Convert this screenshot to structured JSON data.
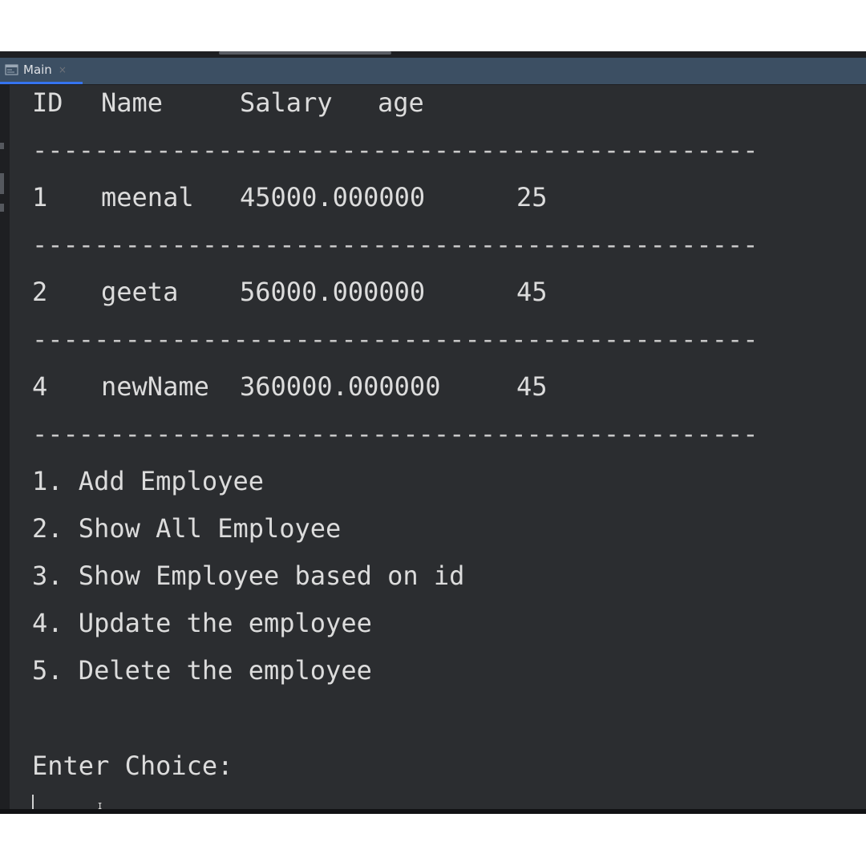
{
  "tab": {
    "label": "Main",
    "close": "×",
    "icon": "console-icon"
  },
  "table": {
    "headers": [
      "ID",
      "Name",
      "Salary",
      "age"
    ],
    "separator": "-----------------------------------------------",
    "rows": [
      {
        "id": "1",
        "name": "meenal",
        "salary": "45000.000000",
        "age": "25"
      },
      {
        "id": "2",
        "name": "geeta",
        "salary": "56000.000000",
        "age": "45"
      },
      {
        "id": "4",
        "name": "newName",
        "salary": "360000.000000",
        "age": "45"
      }
    ]
  },
  "menu": {
    "items": [
      "1. Add Employee",
      "2. Show All Employee",
      "3. Show Employee based on id",
      "4. Update the employee",
      "5. Delete the employee"
    ],
    "prompt": "Enter Choice:"
  },
  "colors": {
    "background": "#2b2d30",
    "text": "#dcdcdc",
    "tab_accent": "#3574f0"
  }
}
